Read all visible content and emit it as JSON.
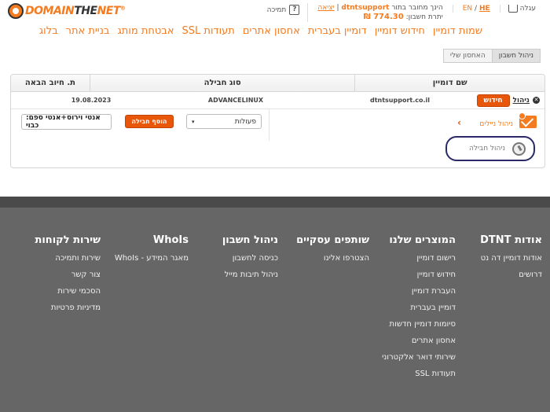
{
  "logo": {
    "part1": "DOMAIN",
    "part2": "THE",
    "part3": "NET",
    "reg": "®"
  },
  "topbar": {
    "cart_label": "עגלה",
    "lang_en": "EN",
    "lang_sep": "/",
    "lang_he": "HE",
    "logged_in_prefix": "הינך מחובר בתור",
    "username": "dtntsupport",
    "logout": "יציאה",
    "balance_label": "יתרת חשבון:",
    "balance_value": "774.30 ₪",
    "support_label": "תמיכה",
    "support_icon_glyph": "?"
  },
  "mainnav": [
    "שמות דומיין",
    "חידוש דומיין",
    "דומיין בעברית",
    "אחסון אתרים",
    "תעודות SSL",
    "אבטחת מותג",
    "בניית אתר",
    "בלוג"
  ],
  "breadcrumbs": {
    "first": "ניהול חשבון",
    "second": "האחסון שלי"
  },
  "table": {
    "headers": {
      "domain": "שם דומיין",
      "package": "סוג חבילה",
      "next_billing": "ת. חיוב הבאה"
    },
    "row": {
      "manage": "ניהול",
      "renew": "חידוש",
      "domain": "dtntsupport.co.il",
      "package": "ADVANCELINUX",
      "date": "19.08.2023"
    },
    "sub": {
      "mail_manage": "ניהול ניילים",
      "package_manage": "ניהול חבילה",
      "actions_select": "פעולות",
      "add_package": "הוסף חבילה",
      "package_input_value": "אנטי וירוס+אנטי ספם: כבוי"
    }
  },
  "footer": {
    "columns": [
      {
        "title": "אודות DTNT",
        "items": [
          "אודות דומיין דה נט",
          "דרושים"
        ]
      },
      {
        "title": "המוצרים שלנו",
        "items": [
          "רישום דומיין",
          "חידוש דומיין",
          "העברת דומיין",
          "דומיין בעברית",
          "סיומות דומיין חדשות",
          "אחסון אתרים",
          "שירותי דואר אלקטרוני",
          "תעודות SSL"
        ]
      },
      {
        "title": "שותפים עסקיים",
        "items": [
          "הצטרפו אלינו"
        ]
      },
      {
        "title": "ניהול חשבון",
        "items": [
          "כניסה לחשבון",
          "ניהול תיבות מייל"
        ]
      },
      {
        "title": "WhoIs",
        "items": [
          "מאגר המידע - WhoIs"
        ]
      },
      {
        "title": "שירות לקוחות",
        "items": [
          "שירות ותמיכה",
          "צור קשר",
          "הסכמי שירות",
          "מדיניות פרטיות"
        ]
      }
    ]
  },
  "colors": {
    "accent": "#f47b20",
    "button": "#e8560a",
    "footer": "#666666",
    "highlight_ring": "#2a2a6a"
  }
}
